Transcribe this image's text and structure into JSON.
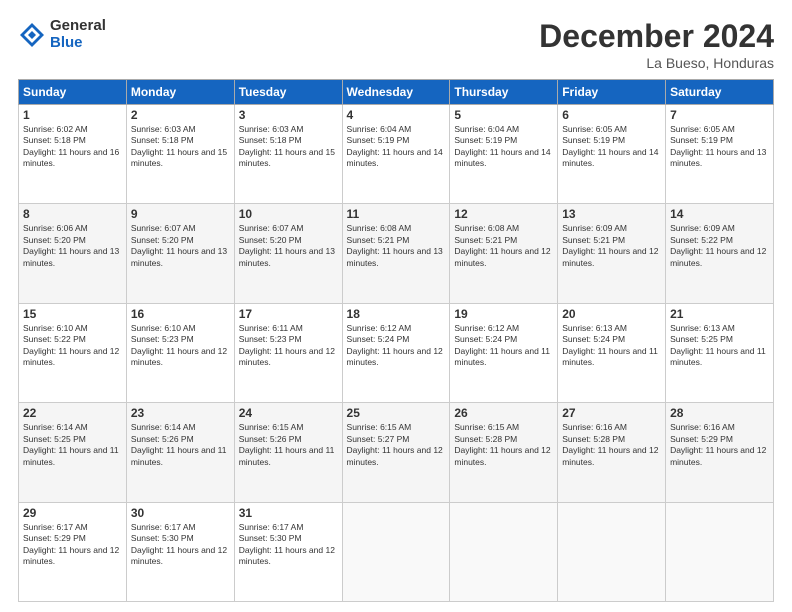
{
  "logo": {
    "general": "General",
    "blue": "Blue"
  },
  "title": "December 2024",
  "location": "La Bueso, Honduras",
  "days_of_week": [
    "Sunday",
    "Monday",
    "Tuesday",
    "Wednesday",
    "Thursday",
    "Friday",
    "Saturday"
  ],
  "weeks": [
    [
      {
        "day": "1",
        "sunrise": "6:02 AM",
        "sunset": "5:18 PM",
        "daylight": "11 hours and 16 minutes."
      },
      {
        "day": "2",
        "sunrise": "6:03 AM",
        "sunset": "5:18 PM",
        "daylight": "11 hours and 15 minutes."
      },
      {
        "day": "3",
        "sunrise": "6:03 AM",
        "sunset": "5:18 PM",
        "daylight": "11 hours and 15 minutes."
      },
      {
        "day": "4",
        "sunrise": "6:04 AM",
        "sunset": "5:19 PM",
        "daylight": "11 hours and 14 minutes."
      },
      {
        "day": "5",
        "sunrise": "6:04 AM",
        "sunset": "5:19 PM",
        "daylight": "11 hours and 14 minutes."
      },
      {
        "day": "6",
        "sunrise": "6:05 AM",
        "sunset": "5:19 PM",
        "daylight": "11 hours and 14 minutes."
      },
      {
        "day": "7",
        "sunrise": "6:05 AM",
        "sunset": "5:19 PM",
        "daylight": "11 hours and 13 minutes."
      }
    ],
    [
      {
        "day": "8",
        "sunrise": "6:06 AM",
        "sunset": "5:20 PM",
        "daylight": "11 hours and 13 minutes."
      },
      {
        "day": "9",
        "sunrise": "6:07 AM",
        "sunset": "5:20 PM",
        "daylight": "11 hours and 13 minutes."
      },
      {
        "day": "10",
        "sunrise": "6:07 AM",
        "sunset": "5:20 PM",
        "daylight": "11 hours and 13 minutes."
      },
      {
        "day": "11",
        "sunrise": "6:08 AM",
        "sunset": "5:21 PM",
        "daylight": "11 hours and 13 minutes."
      },
      {
        "day": "12",
        "sunrise": "6:08 AM",
        "sunset": "5:21 PM",
        "daylight": "11 hours and 12 minutes."
      },
      {
        "day": "13",
        "sunrise": "6:09 AM",
        "sunset": "5:21 PM",
        "daylight": "11 hours and 12 minutes."
      },
      {
        "day": "14",
        "sunrise": "6:09 AM",
        "sunset": "5:22 PM",
        "daylight": "11 hours and 12 minutes."
      }
    ],
    [
      {
        "day": "15",
        "sunrise": "6:10 AM",
        "sunset": "5:22 PM",
        "daylight": "11 hours and 12 minutes."
      },
      {
        "day": "16",
        "sunrise": "6:10 AM",
        "sunset": "5:23 PM",
        "daylight": "11 hours and 12 minutes."
      },
      {
        "day": "17",
        "sunrise": "6:11 AM",
        "sunset": "5:23 PM",
        "daylight": "11 hours and 12 minutes."
      },
      {
        "day": "18",
        "sunrise": "6:12 AM",
        "sunset": "5:24 PM",
        "daylight": "11 hours and 12 minutes."
      },
      {
        "day": "19",
        "sunrise": "6:12 AM",
        "sunset": "5:24 PM",
        "daylight": "11 hours and 11 minutes."
      },
      {
        "day": "20",
        "sunrise": "6:13 AM",
        "sunset": "5:24 PM",
        "daylight": "11 hours and 11 minutes."
      },
      {
        "day": "21",
        "sunrise": "6:13 AM",
        "sunset": "5:25 PM",
        "daylight": "11 hours and 11 minutes."
      }
    ],
    [
      {
        "day": "22",
        "sunrise": "6:14 AM",
        "sunset": "5:25 PM",
        "daylight": "11 hours and 11 minutes."
      },
      {
        "day": "23",
        "sunrise": "6:14 AM",
        "sunset": "5:26 PM",
        "daylight": "11 hours and 11 minutes."
      },
      {
        "day": "24",
        "sunrise": "6:15 AM",
        "sunset": "5:26 PM",
        "daylight": "11 hours and 11 minutes."
      },
      {
        "day": "25",
        "sunrise": "6:15 AM",
        "sunset": "5:27 PM",
        "daylight": "11 hours and 12 minutes."
      },
      {
        "day": "26",
        "sunrise": "6:15 AM",
        "sunset": "5:28 PM",
        "daylight": "11 hours and 12 minutes."
      },
      {
        "day": "27",
        "sunrise": "6:16 AM",
        "sunset": "5:28 PM",
        "daylight": "11 hours and 12 minutes."
      },
      {
        "day": "28",
        "sunrise": "6:16 AM",
        "sunset": "5:29 PM",
        "daylight": "11 hours and 12 minutes."
      }
    ],
    [
      {
        "day": "29",
        "sunrise": "6:17 AM",
        "sunset": "5:29 PM",
        "daylight": "11 hours and 12 minutes."
      },
      {
        "day": "30",
        "sunrise": "6:17 AM",
        "sunset": "5:30 PM",
        "daylight": "11 hours and 12 minutes."
      },
      {
        "day": "31",
        "sunrise": "6:17 AM",
        "sunset": "5:30 PM",
        "daylight": "11 hours and 12 minutes."
      },
      null,
      null,
      null,
      null
    ]
  ]
}
